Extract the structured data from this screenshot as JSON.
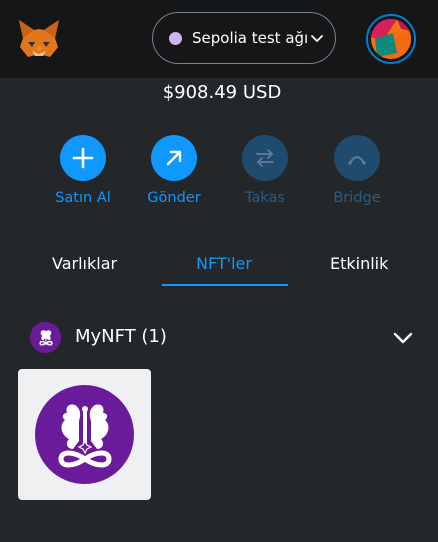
{
  "header": {
    "network_label": "Sepolia test ağı"
  },
  "balance": "$908.49 USD",
  "actions": [
    {
      "label": "Satın Al",
      "icon": "plus-icon",
      "enabled": true
    },
    {
      "label": "Gönder",
      "icon": "arrow-up-right-icon",
      "enabled": true
    },
    {
      "label": "Takas",
      "icon": "swap-icon",
      "enabled": false
    },
    {
      "label": "Bridge",
      "icon": "bridge-icon",
      "enabled": false
    }
  ],
  "tabs": [
    {
      "label": "Varlıklar",
      "active": false
    },
    {
      "label": "NFT'ler",
      "active": true
    },
    {
      "label": "Etkinlik",
      "active": false
    }
  ],
  "collection": {
    "name": "MyNFT (1)",
    "icon": "dragon-emblem-icon"
  },
  "colors": {
    "accent": "#1098fc",
    "disabled_accent": "#1f4b6e",
    "nft_purple": "#6a1b9a",
    "background": "#24272a",
    "header_background": "#141618"
  }
}
